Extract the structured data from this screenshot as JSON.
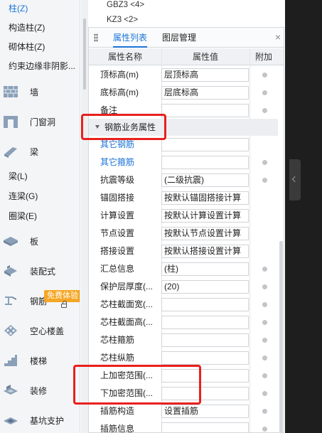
{
  "nav": {
    "subitems_top": [
      {
        "label": "柱(Z)",
        "active": true
      },
      {
        "label": "构造柱(Z)",
        "active": false
      },
      {
        "label": "砌体柱(Z)",
        "active": false
      },
      {
        "label": "约束边缘非阴影...",
        "active": false
      }
    ],
    "cat_wall": "墙",
    "cat_door": "门窗洞",
    "cat_beam": "梁",
    "subitems_beam": [
      "梁(L)",
      "连梁(G)",
      "圈梁(E)"
    ],
    "cat_slab": "板",
    "cat_prefab": "装配式",
    "cat_rebar": "钢筋",
    "free_badge": "免费体验",
    "cat_hollow": "空心楼盖",
    "cat_stairs": "楼梯",
    "cat_decor": "装修",
    "cat_pit": "基坑支护"
  },
  "top_list": [
    "GBZ3 <4>",
    "KZ3 <2>"
  ],
  "panel": {
    "tab_properties": "属性列表",
    "tab_layers": "图层管理",
    "close": "×",
    "col_name": "属性名称",
    "col_value": "属性值",
    "col_extra": "附加",
    "group_label": "钢筋业务属性",
    "rows_before": [
      {
        "name": "顶标高(m)",
        "value": "层顶标高"
      },
      {
        "name": "底标高(m)",
        "value": "层底标高"
      },
      {
        "name": "备注",
        "value": ""
      }
    ],
    "rows_after": [
      {
        "name": "其它钢筋",
        "value": "",
        "link": true,
        "dot": false
      },
      {
        "name": "其它箍筋",
        "value": "",
        "link": true,
        "dot": true
      },
      {
        "name": "抗震等级",
        "value": "(二级抗震)",
        "link": false,
        "dot": true
      },
      {
        "name": "锚固搭接",
        "value": "按默认锚固搭接计算",
        "link": false,
        "dot": false
      },
      {
        "name": "计算设置",
        "value": "按默认计算设置计算",
        "link": false,
        "dot": false
      },
      {
        "name": "节点设置",
        "value": "按默认节点设置计算",
        "link": false,
        "dot": false
      },
      {
        "name": "搭接设置",
        "value": "按默认搭接设置计算",
        "link": false,
        "dot": false
      },
      {
        "name": "汇总信息",
        "value": "(柱)",
        "link": false,
        "dot": true
      },
      {
        "name": "保护层厚度(...",
        "value": "(20)",
        "link": false,
        "dot": true
      },
      {
        "name": "芯柱截面宽(...",
        "value": "",
        "link": false,
        "dot": true
      },
      {
        "name": "芯柱截面高(...",
        "value": "",
        "link": false,
        "dot": true
      },
      {
        "name": "芯柱箍筋",
        "value": "",
        "link": false,
        "dot": true
      },
      {
        "name": "芯柱纵筋",
        "value": "",
        "link": false,
        "dot": true
      },
      {
        "name": "上加密范围(...",
        "value": "",
        "link": false,
        "dot": true
      },
      {
        "name": "下加密范围(...",
        "value": "",
        "link": false,
        "dot": true
      },
      {
        "name": "插筋构造",
        "value": "设置插筋",
        "link": false,
        "dot": true
      },
      {
        "name": "插筋信息",
        "value": "",
        "link": false,
        "dot": true
      }
    ]
  },
  "colors": {
    "accent": "#1a73d6",
    "highlight": "#e8201e",
    "badge": "#f5a623"
  }
}
